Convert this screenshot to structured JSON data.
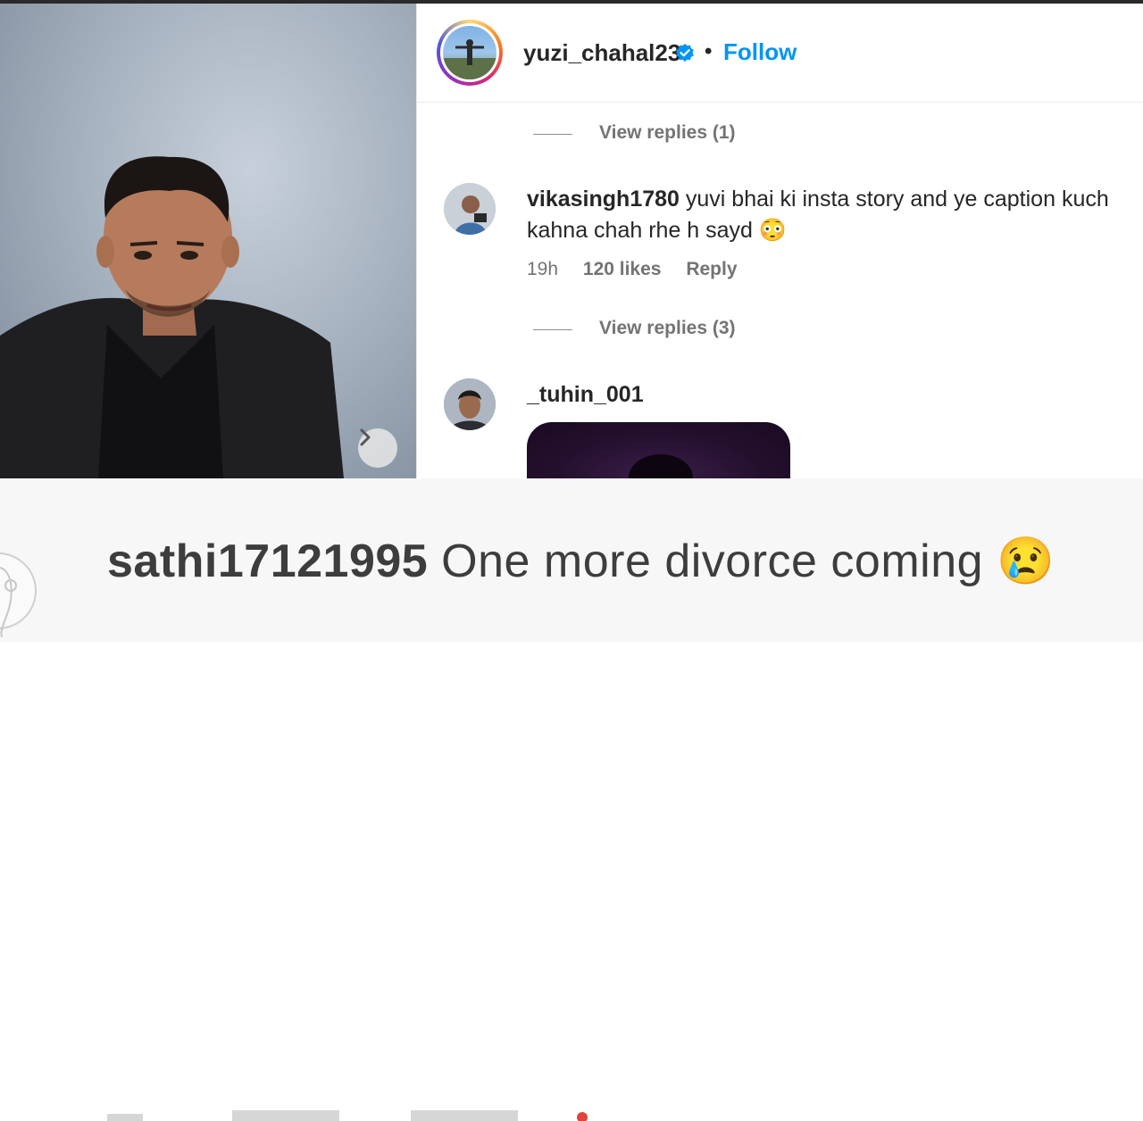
{
  "post": {
    "username": "yuzi_chahal23",
    "follow_label": "Follow",
    "separator": "•",
    "verified_icon": "verified-badge-icon"
  },
  "comments": {
    "view_replies_1": "View replies (1)",
    "comment_1": {
      "username": "vikasingh1780",
      "text": " yuvi bhai ki insta story and ye caption kuch kahna chah rhe h sayd 😳",
      "time": "19h",
      "likes": "120 likes",
      "reply": "Reply"
    },
    "view_replies_2": "View replies (3)",
    "comment_2": {
      "username": "_tuhin_001"
    }
  },
  "zoomed_comment": {
    "username": "sathi17121995",
    "text": " One more divorce coming 😢"
  },
  "colors": {
    "accent": "#0095f6",
    "text": "#262626",
    "muted": "#737373"
  }
}
